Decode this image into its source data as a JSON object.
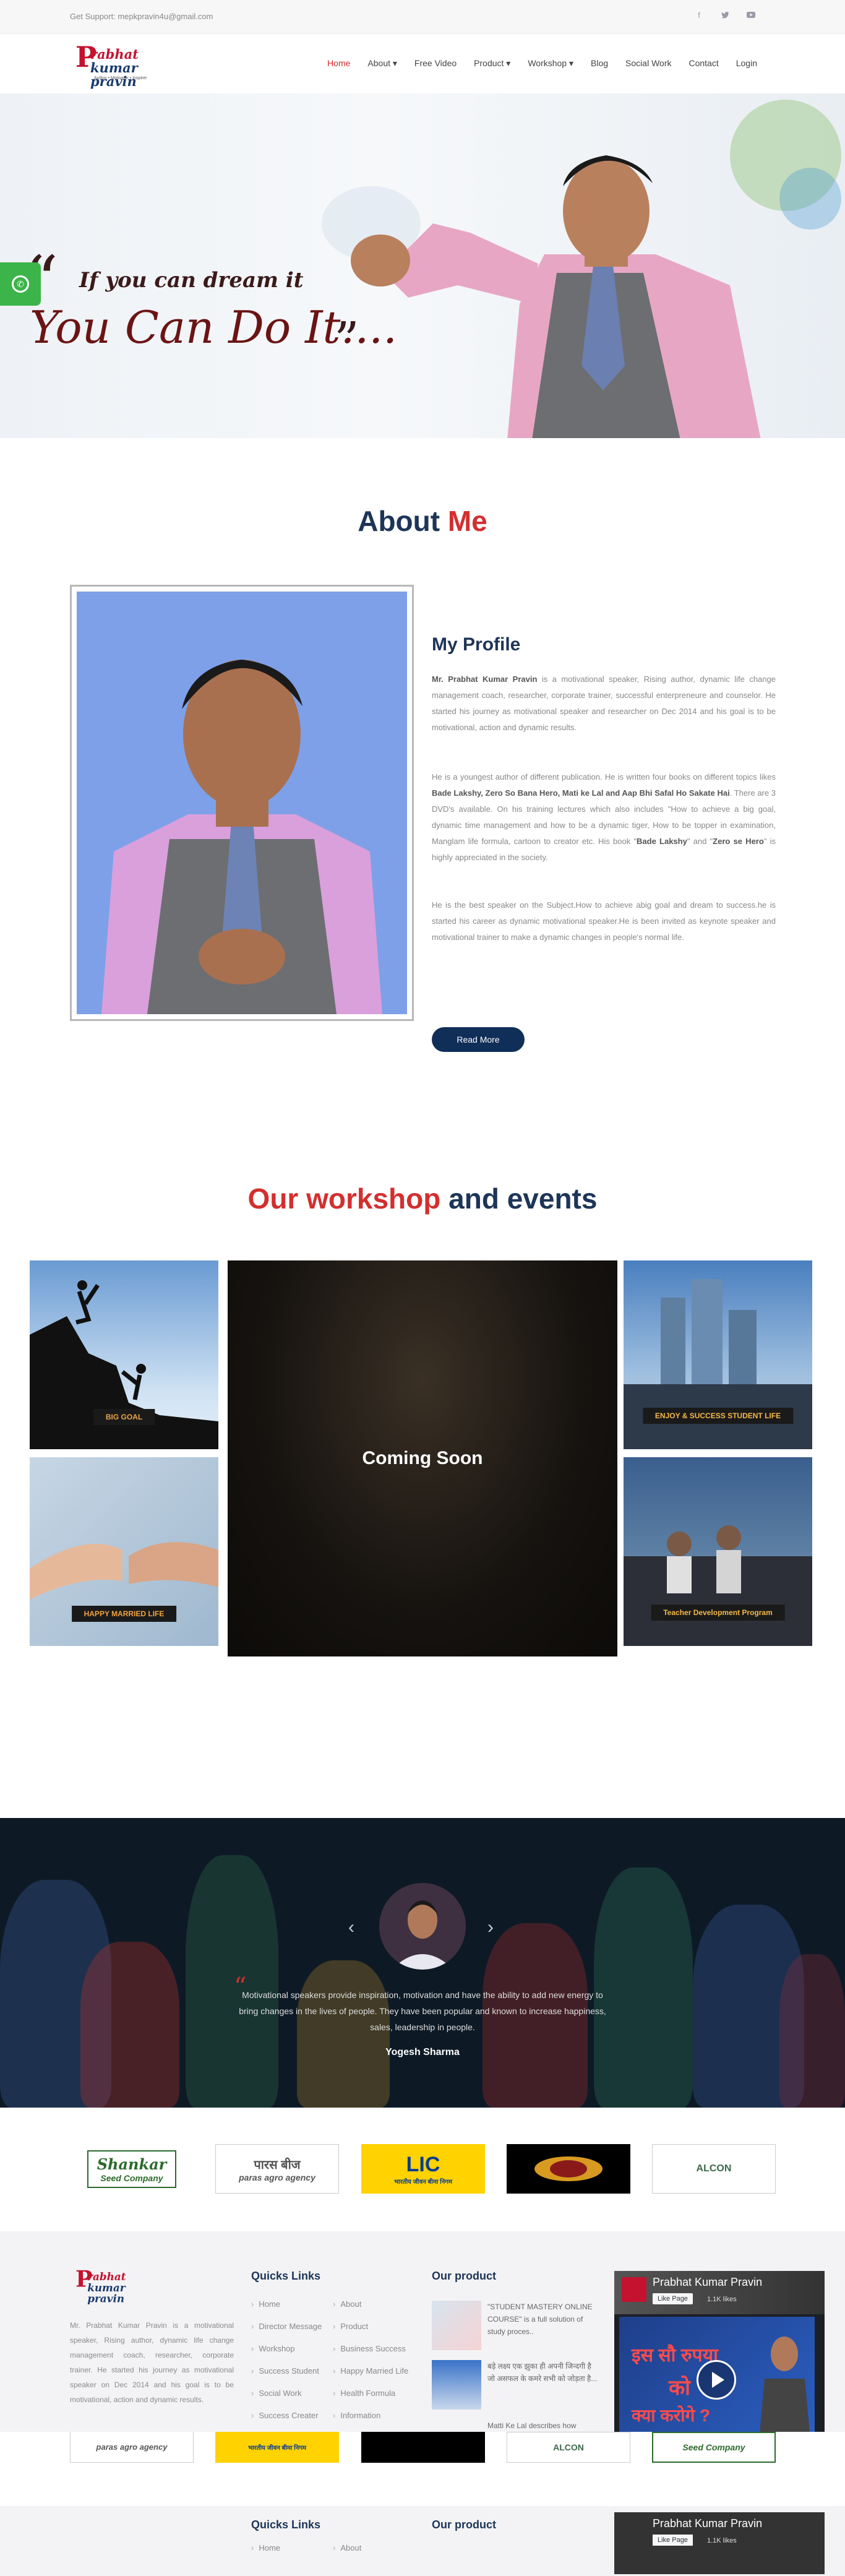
{
  "topbar": {
    "support": "Get Support: mepkpravin4u@gmail.com",
    "social": [
      "facebook-icon",
      "twitter-icon",
      "youtube-icon"
    ]
  },
  "logo": {
    "first_letter": "P",
    "line1": "rabhat",
    "line2": "kumar pravin",
    "tagline": "Author • Motivator • Inspirer"
  },
  "nav": {
    "items": [
      {
        "label": "Home",
        "active": true
      },
      {
        "label": "About ▾"
      },
      {
        "label": "Free Video"
      },
      {
        "label": "Product ▾"
      },
      {
        "label": "Workshop ▾"
      },
      {
        "label": "Blog"
      },
      {
        "label": "Social Work"
      },
      {
        "label": "Contact"
      },
      {
        "label": "Login"
      }
    ]
  },
  "hero": {
    "quote_open": "“",
    "line1": "If you can dream it",
    "line2": "You Can Do It....",
    "quote_close": "”"
  },
  "about": {
    "title_a": "About",
    "title_b": "Me",
    "profile_title": "My Profile",
    "p1_name": "Mr. Prabhat Kumar Pravin",
    "p1_rest": " is a motivational speaker, Rising author, dynamic life change management coach, researcher, corporate trainer, successful enterpreneure and counselor. He started his journey as motivational speaker and researcher on Dec 2014 and his goal is to be motivational, action and dynamic results.",
    "p2_a": "He is a youngest author of different publication. He is written four books on different topics likes ",
    "p2_b1": "Bade Lakshy, Zero So Bana Hero, Mati ke Lal and Aap Bhi Safal Ho Sakate Hai",
    "p2_c": ". There are 3 DVD's available. On his training lectures which also includes \"How to achieve a big goal, dynamic time management and how to be a dynamic tiger, How to be topper in examination, Manglam life formula, cartoon to creator etc. His book \"",
    "p2_b2": "Bade Lakshy",
    "p2_d": "\" and \"",
    "p2_b3": "Zero se Hero",
    "p2_e": "\" is highly appreciated in the society.",
    "p3": "He is the best speaker on the Subject.How to achieve abig goal and dream to success.he is started his career as dynamic motivational speaker.He is been invited as keynote speaker and motivational trainer to make a dynamic changes in people's normal life.",
    "read_more": "Read More"
  },
  "workshop": {
    "title_a": "Our workshop",
    "title_b": "and events",
    "tiles": [
      "BIG GOAL",
      "HAPPY MARRIED LIFE",
      "ENJOY & SUCCESS STUDENT LIFE",
      "Teacher Development Program"
    ],
    "coming_soon": "Coming Soon"
  },
  "testimonial": {
    "quote_mark": "“",
    "text": "Motivational speakers provide inspiration, motivation and have the ability to add new energy to bring changes in the lives of people. They have been popular and known to increase happiness, sales, leadership in people.",
    "name": "Yogesh Sharma",
    "prev": "‹",
    "next": "›"
  },
  "clients": [
    {
      "line1": "Shankar",
      "line2": "Seed Company"
    },
    {
      "line1": "पारस बीज",
      "line2": "paras agro agency"
    },
    {
      "line1": "LIC",
      "line2": "भारतीय जीवन बीमा निगम"
    },
    {
      "line1": "",
      "line2": ""
    },
    {
      "line1": "ALCON",
      "line2": ""
    }
  ],
  "footer": {
    "about": "Mr. Prabhat Kumar Pravin is a motivational speaker, Rising author, dynamic life change management coach, researcher, corporate trainer. He started his journey as motivational speaker on Dec 2014 and his goal is to be motivational, action and dynamic results.",
    "quick_title": "Quicks Links",
    "links_left": [
      "Home",
      "Director Message",
      "Workshop",
      "Success Student",
      "Social Work",
      "Success Creater"
    ],
    "links_right": [
      "About",
      "Product",
      "Business Success",
      "Happy Married Life",
      "Health Formula",
      "Information"
    ],
    "product_title": "Our product",
    "products": [
      "\"STUDENT MASTERY ONLINE COURSE\" is a full solution of study proces..",
      "बड़े लक्ष्य एक झुका ही अपनी जिन्दगी है जो असफल के कमरे सभी को जोड़ता है...",
      "Matti Ke Lal describes how"
    ],
    "fb": {
      "page_name": "Prabhat Kumar Pravin",
      "like": "Like Page",
      "likes": "1.1K likes",
      "video_line1": "इस सौ रुपया",
      "video_line2": "को",
      "video_line3": "क्या करोगे ?"
    }
  },
  "dup": {
    "quick_title": "Quicks Links",
    "product_title": "Our product",
    "home": "Home",
    "about": "About",
    "fb_name": "Prabhat Kumar Pravin",
    "fb_like": "Like Page",
    "fb_likes": "1.1K likes"
  }
}
